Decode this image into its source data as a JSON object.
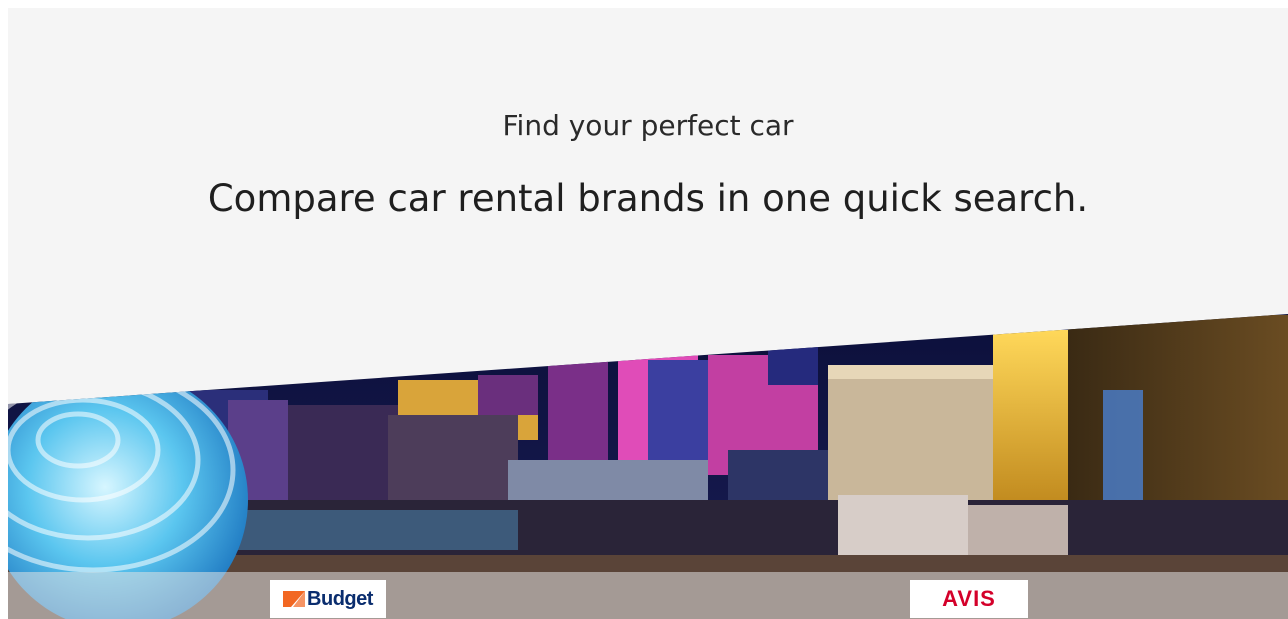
{
  "hero": {
    "subtitle": "Find your perfect car",
    "headline": "Compare car rental brands in one quick search."
  },
  "brands": [
    {
      "name": "Budget",
      "color": "#0a2d6e",
      "accent": "#f26722"
    },
    {
      "name": "AVIS",
      "color": "#d4002a"
    }
  ],
  "colors": {
    "background": "#f5f5f5",
    "text": "#222222"
  }
}
